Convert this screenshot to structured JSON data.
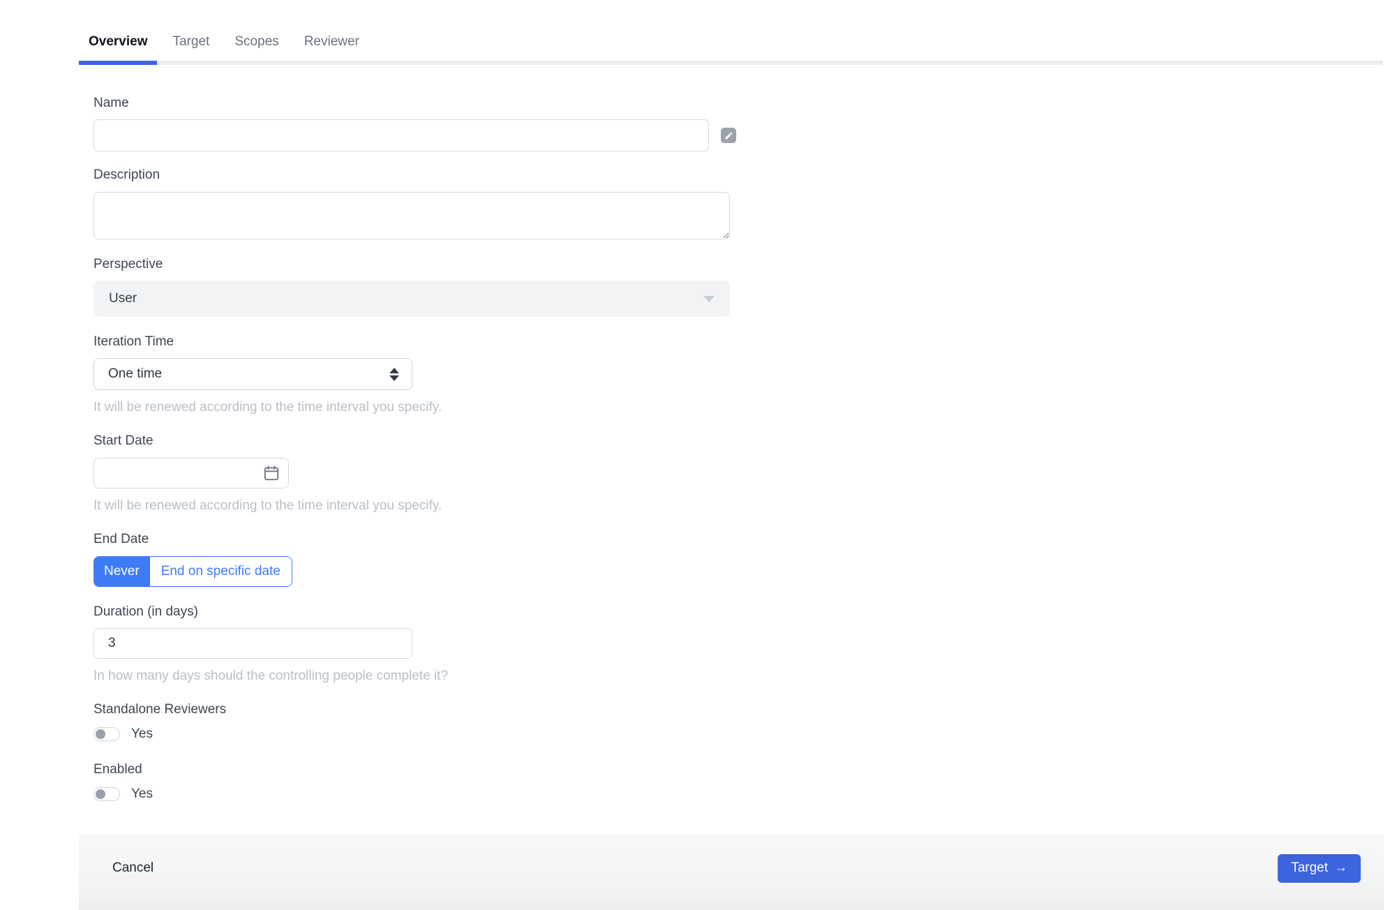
{
  "tabs": {
    "items": [
      {
        "label": "Overview"
      },
      {
        "label": "Target"
      },
      {
        "label": "Scopes"
      },
      {
        "label": "Reviewer"
      }
    ],
    "active": "Overview"
  },
  "form": {
    "name": {
      "label": "Name",
      "value": ""
    },
    "description": {
      "label": "Description",
      "value": ""
    },
    "perspective": {
      "label": "Perspective",
      "value": "User"
    },
    "iteration_time": {
      "label": "Iteration Time",
      "value": "One time",
      "helper": "It will be renewed according to the time interval you specify."
    },
    "start_date": {
      "label": "Start Date",
      "value": "",
      "helper": "It will be renewed according to the time interval you specify."
    },
    "end_date": {
      "label": "End Date",
      "options": [
        "Never",
        "End on specific date"
      ],
      "selected": "Never"
    },
    "duration": {
      "label": "Duration (in days)",
      "value": "3",
      "helper": "In how many days should the controlling people complete it?"
    },
    "standalone_reviewers": {
      "label": "Standalone Reviewers",
      "toggle_label": "Yes",
      "state": "off"
    },
    "enabled": {
      "label": "Enabled",
      "toggle_label": "Yes",
      "state": "off"
    }
  },
  "footer": {
    "cancel_label": "Cancel",
    "next_label": "Target",
    "next_arrow": "→"
  },
  "icons": {
    "edit": "pencil-icon",
    "calendar": "calendar-icon",
    "perspective_caret": "caret-down-icon",
    "iteration_stepper": "caret-up-down-icon",
    "next_arrow": "arrow-right-icon"
  },
  "colors": {
    "accent_primary": "#3d63dd",
    "accent_blue": "#3e7bf6",
    "tab_line": "#ededee",
    "helper_text": "#b8bfc7",
    "label_text": "#3d4654"
  }
}
